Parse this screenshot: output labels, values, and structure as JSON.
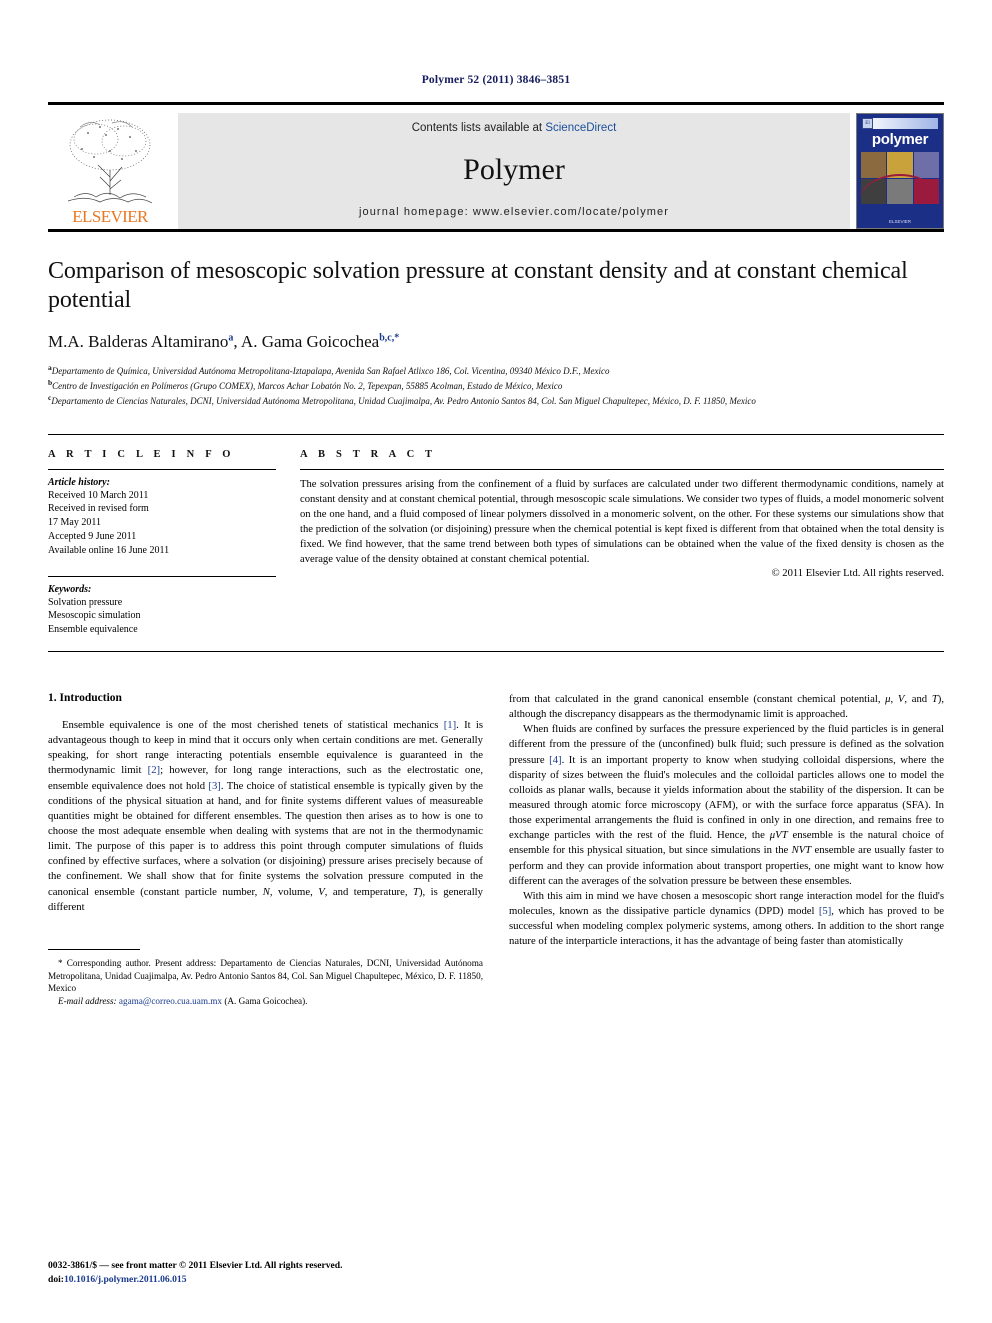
{
  "running_head": "Polymer 52 (2011) 3846–3851",
  "masthead": {
    "publisher_wordmark": "ELSEVIER",
    "contents_prefix": "Contents lists available at ",
    "contents_link": "ScienceDirect",
    "journal_name": "Polymer",
    "homepage": "journal homepage: www.elsevier.com/locate/polymer",
    "cover_title": "polymer",
    "cover_badge": "El",
    "cover_footer": "ELSEVIER",
    "accent_orange": "#e87722",
    "link_blue": "#1a4f9c",
    "cover_blue": "#1c2f86"
  },
  "article": {
    "title": "Comparison of mesoscopic solvation pressure at constant density and at constant chemical potential",
    "authors": "M.A. Balderas Altamirano",
    "author_marker_1": "a",
    "authors_2": ", A. Gama Goicochea",
    "author_marker_2": "b,c,*",
    "affiliations": [
      {
        "marker": "a",
        "text": "Departamento de Química, Universidad Autónoma Metropolitana-Iztapalapa, Avenida San Rafael Atlixco 186, Col. Vicentina, 09340 México D.F., Mexico"
      },
      {
        "marker": "b",
        "text": "Centro de Investigación en Polímeros (Grupo COMEX), Marcos Achar Lobatón No. 2, Tepexpan, 55885 Acolman, Estado de México, Mexico"
      },
      {
        "marker": "c",
        "text": "Departamento de Ciencias Naturales, DCNI, Universidad Autónoma Metropolitana, Unidad Cuajimalpa, Av. Pedro Antonio Santos 84, Col. San Miguel Chapultepec, México, D. F. 11850, Mexico"
      }
    ]
  },
  "article_info": {
    "heading": "A R T I C L E    I N F O",
    "history_label": "Article history:",
    "history": [
      "Received 10 March 2011",
      "Received in revised form",
      "17 May 2011",
      "Accepted 9 June 2011",
      "Available online 16 June 2011"
    ],
    "keywords_label": "Keywords:",
    "keywords": [
      "Solvation pressure",
      "Mesoscopic simulation",
      "Ensemble equivalence"
    ]
  },
  "abstract": {
    "heading": "A B S T R A C T",
    "text": "The solvation pressures arising from the confinement of a fluid by surfaces are calculated under two different thermodynamic conditions, namely at constant density and at constant chemical potential, through mesoscopic scale simulations. We consider two types of fluids, a model monomeric solvent on the one hand, and a fluid composed of linear polymers dissolved in a monomeric solvent, on the other. For these systems our simulations show that the prediction of the solvation (or disjoining) pressure when the chemical potential is kept fixed is different from that obtained when the total density is fixed. We find however, that the same trend between both types of simulations can be obtained when the value of the fixed density is chosen as the average value of the density obtained at constant chemical potential.",
    "copyright": "© 2011 Elsevier Ltd. All rights reserved."
  },
  "body": {
    "section_heading": "1. Introduction",
    "left_paragraph_1_a": "Ensemble equivalence is one of the most cherished tenets of statistical mechanics ",
    "left_ref_1": "[1]",
    "left_paragraph_1_b": ". It is advantageous though to keep in mind that it occurs only when certain conditions are met. Generally speaking, for short range interacting potentials ensemble equivalence is guaranteed in the thermodynamic limit ",
    "left_ref_2": "[2]",
    "left_paragraph_1_c": "; however, for long range interactions, such as the electrostatic one, ensemble equivalence does not hold ",
    "left_ref_3": "[3]",
    "left_paragraph_1_d": ". The choice of statistical ensemble is typically given by the conditions of the physical situation at hand, and for finite systems different values of measureable quantities might be obtained for different ensembles. The question then arises as to how is one to choose the most adequate ensemble when dealing with systems that are not in the thermodynamic limit. The purpose of this paper is to address this point through computer simulations of fluids confined by effective surfaces, where a solvation (or disjoining) pressure arises precisely because of the confinement. We shall show that for finite systems the solvation pressure computed in the canonical ensemble (constant particle number, ",
    "left_var_n": "N",
    "left_paragraph_1_e": ", volume, ",
    "left_var_v": "V",
    "left_paragraph_1_f": ", and temperature, ",
    "left_var_t": "T",
    "left_paragraph_1_g": "), is generally different",
    "right_paragraph_1_a": "from that calculated in the grand canonical ensemble (constant chemical potential, ",
    "right_var_mu": "μ",
    "right_paragraph_1_b": ", ",
    "right_var_v": "V",
    "right_paragraph_1_c": ", and ",
    "right_var_t": "T",
    "right_paragraph_1_d": "), although the discrepancy disappears as the thermodynamic limit is approached.",
    "right_paragraph_2_a": "When fluids are confined by surfaces the pressure experienced by the fluid particles is in general different from the pressure of the (unconfined) bulk fluid; such pressure is defined as the solvation pressure ",
    "right_ref_4": "[4]",
    "right_paragraph_2_b": ". It is an important property to know when studying colloidal dispersions, where the disparity of sizes between the fluid's molecules and the colloidal particles allows one to model the colloids as planar walls, because it yields information about the stability of the dispersion. It can be measured through atomic force microscopy (AFM), or with the surface force apparatus (SFA). In those experimental arrangements the fluid is confined in only in one direction, and remains free to exchange particles with the rest of the fluid. Hence, the ",
    "right_var_muvt": "μVT",
    "right_paragraph_2_c": " ensemble is the natural choice of ensemble for this physical situation, but since simulations in the ",
    "right_var_nvt": "NVT",
    "right_paragraph_2_d": " ensemble are usually faster to perform and they can provide information about transport properties, one might want to know how different can the averages of the solvation pressure be between these ensembles.",
    "right_paragraph_3_a": "With this aim in mind we have chosen a mesoscopic short range interaction model for the fluid's molecules, known as the dissipative particle dynamics (DPD) model ",
    "right_ref_5": "[5]",
    "right_paragraph_3_b": ", which has proved to be successful when modeling complex polymeric systems, among others. In addition to the short range nature of the interparticle interactions, it has the advantage of being faster than atomistically"
  },
  "footnote": {
    "corresponding": "* Corresponding author. Present address: Departamento de Ciencias Naturales, DCNI, Universidad Autónoma Metropolitana, Unidad Cuajimalpa, Av. Pedro Antonio Santos 84, Col. San Miguel Chapultepec, México, D. F. 11850, Mexico",
    "email_label": "E-mail address:",
    "email": "agama@correo.cua.uam.mx",
    "email_owner": "(A. Gama Goicochea)."
  },
  "page_footer": {
    "issn_line": "0032-3861/$ — see front matter © 2011 Elsevier Ltd. All rights reserved.",
    "doi_label": "doi:",
    "doi": "10.1016/j.polymer.2011.06.015"
  }
}
